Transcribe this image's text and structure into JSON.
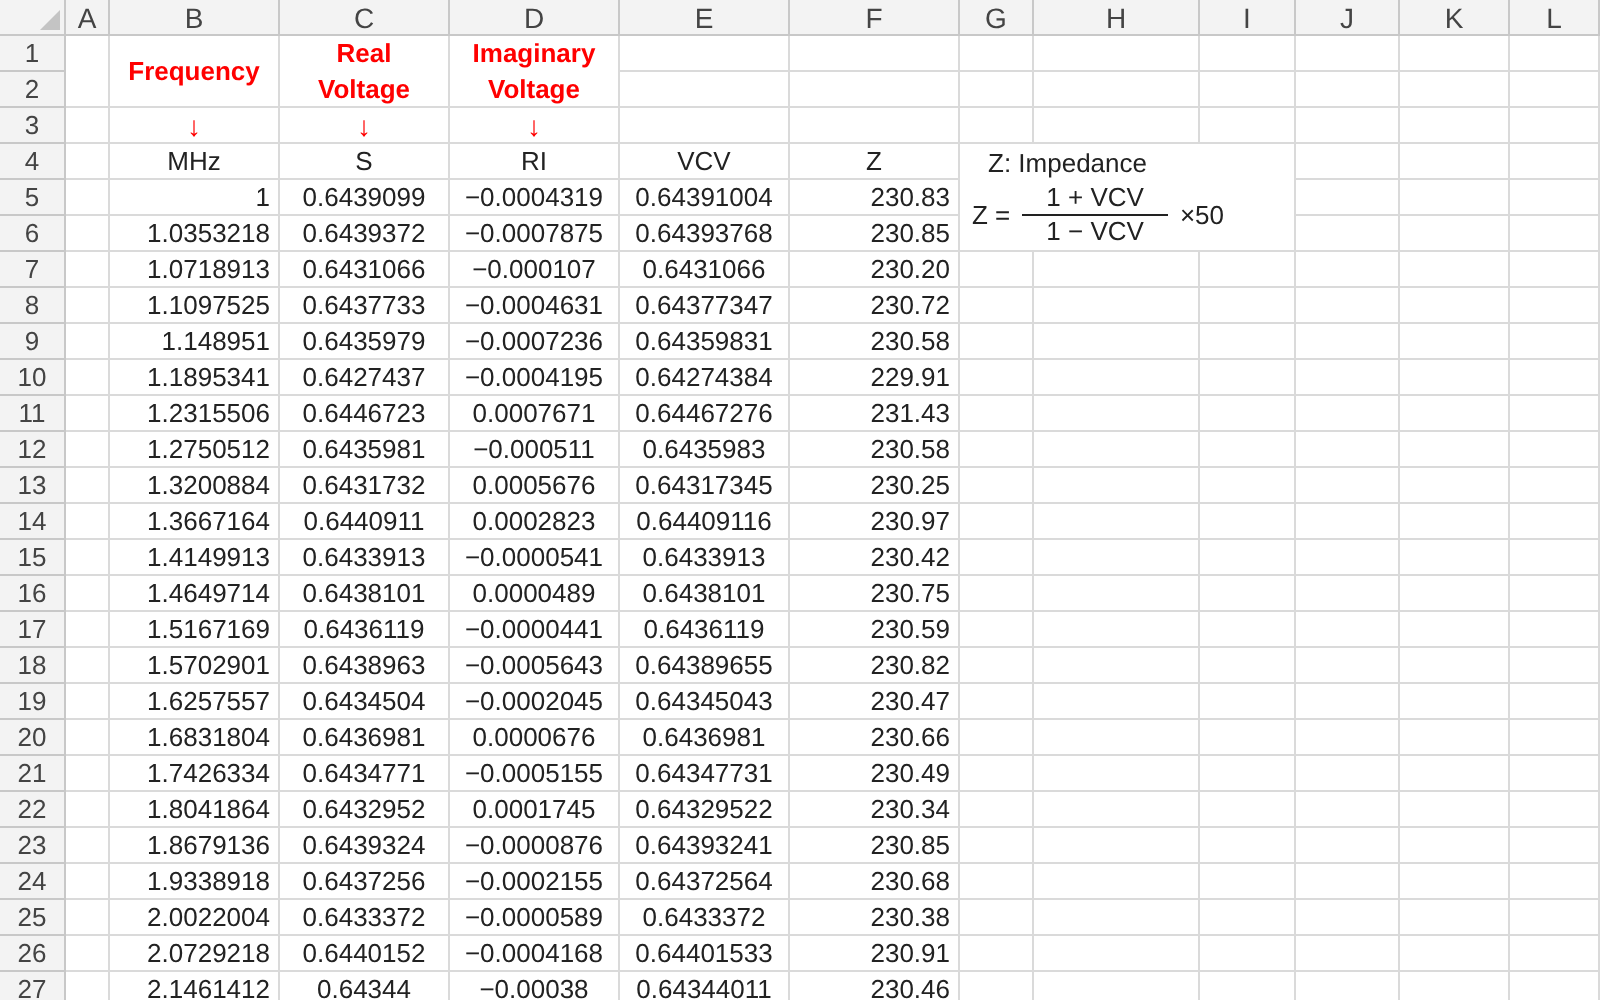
{
  "columns": [
    "A",
    "B",
    "C",
    "D",
    "E",
    "F",
    "G",
    "H",
    "I",
    "J",
    "K",
    "L"
  ],
  "title_rows": {
    "row_numbers": [
      "1",
      "2"
    ],
    "titles": [
      [
        "Frequency"
      ],
      [
        "Real",
        "Voltage"
      ],
      [
        "Imaginary",
        "Voltage"
      ]
    ]
  },
  "arrow_row": {
    "row_number": "3",
    "arrows": [
      "↓",
      "↓",
      "↓"
    ]
  },
  "unit_row": {
    "row_number": "4",
    "cells": [
      "MHz",
      "S",
      "RI",
      "VCV",
      "Z"
    ]
  },
  "rows": [
    {
      "n": "5",
      "cells": [
        "1",
        "0.6439099",
        "−0.0004319",
        "0.64391004",
        "230.83"
      ]
    },
    {
      "n": "6",
      "cells": [
        "1.0353218",
        "0.6439372",
        "−0.0007875",
        "0.64393768",
        "230.85"
      ]
    },
    {
      "n": "7",
      "cells": [
        "1.0718913",
        "0.6431066",
        "−0.000107",
        "0.6431066",
        "230.20"
      ]
    },
    {
      "n": "8",
      "cells": [
        "1.1097525",
        "0.6437733",
        "−0.0004631",
        "0.64377347",
        "230.72"
      ]
    },
    {
      "n": "9",
      "cells": [
        "1.148951",
        "0.6435979",
        "−0.0007236",
        "0.64359831",
        "230.58"
      ]
    },
    {
      "n": "10",
      "cells": [
        "1.1895341",
        "0.6427437",
        "−0.0004195",
        "0.64274384",
        "229.91"
      ]
    },
    {
      "n": "11",
      "cells": [
        "1.2315506",
        "0.6446723",
        "0.0007671",
        "0.64467276",
        "231.43"
      ]
    },
    {
      "n": "12",
      "cells": [
        "1.2750512",
        "0.6435981",
        "−0.000511",
        "0.6435983",
        "230.58"
      ]
    },
    {
      "n": "13",
      "cells": [
        "1.3200884",
        "0.6431732",
        "0.0005676",
        "0.64317345",
        "230.25"
      ]
    },
    {
      "n": "14",
      "cells": [
        "1.3667164",
        "0.6440911",
        "0.0002823",
        "0.64409116",
        "230.97"
      ]
    },
    {
      "n": "15",
      "cells": [
        "1.4149913",
        "0.6433913",
        "−0.0000541",
        "0.6433913",
        "230.42"
      ]
    },
    {
      "n": "16",
      "cells": [
        "1.4649714",
        "0.6438101",
        "0.0000489",
        "0.6438101",
        "230.75"
      ]
    },
    {
      "n": "17",
      "cells": [
        "1.5167169",
        "0.6436119",
        "−0.0000441",
        "0.6436119",
        "230.59"
      ]
    },
    {
      "n": "18",
      "cells": [
        "1.5702901",
        "0.6438963",
        "−0.0005643",
        "0.64389655",
        "230.82"
      ]
    },
    {
      "n": "19",
      "cells": [
        "1.6257557",
        "0.6434504",
        "−0.0002045",
        "0.64345043",
        "230.47"
      ]
    },
    {
      "n": "20",
      "cells": [
        "1.6831804",
        "0.6436981",
        "0.0000676",
        "0.6436981",
        "230.66"
      ]
    },
    {
      "n": "21",
      "cells": [
        "1.7426334",
        "0.6434771",
        "−0.0005155",
        "0.64347731",
        "230.49"
      ]
    },
    {
      "n": "22",
      "cells": [
        "1.8041864",
        "0.6432952",
        "0.0001745",
        "0.64329522",
        "230.34"
      ]
    },
    {
      "n": "23",
      "cells": [
        "1.8679136",
        "0.6439324",
        "−0.0000876",
        "0.64393241",
        "230.85"
      ]
    },
    {
      "n": "24",
      "cells": [
        "1.9338918",
        "0.6437256",
        "−0.0002155",
        "0.64372564",
        "230.68"
      ]
    },
    {
      "n": "25",
      "cells": [
        "2.0022004",
        "0.6433372",
        "−0.0000589",
        "0.6433372",
        "230.38"
      ]
    },
    {
      "n": "26",
      "cells": [
        "2.0729218",
        "0.6440152",
        "−0.0004168",
        "0.64401533",
        "230.91"
      ]
    },
    {
      "n": "27",
      "cells": [
        "2.1461412",
        "0.64344",
        "−0.00038",
        "0.64344011",
        "230.46"
      ]
    }
  ],
  "text_box": {
    "title": "Z: Impedance",
    "lhs": "Z =",
    "numerator": "1 + VCV",
    "denominator": "1 − VCV",
    "factor": "×50"
  }
}
